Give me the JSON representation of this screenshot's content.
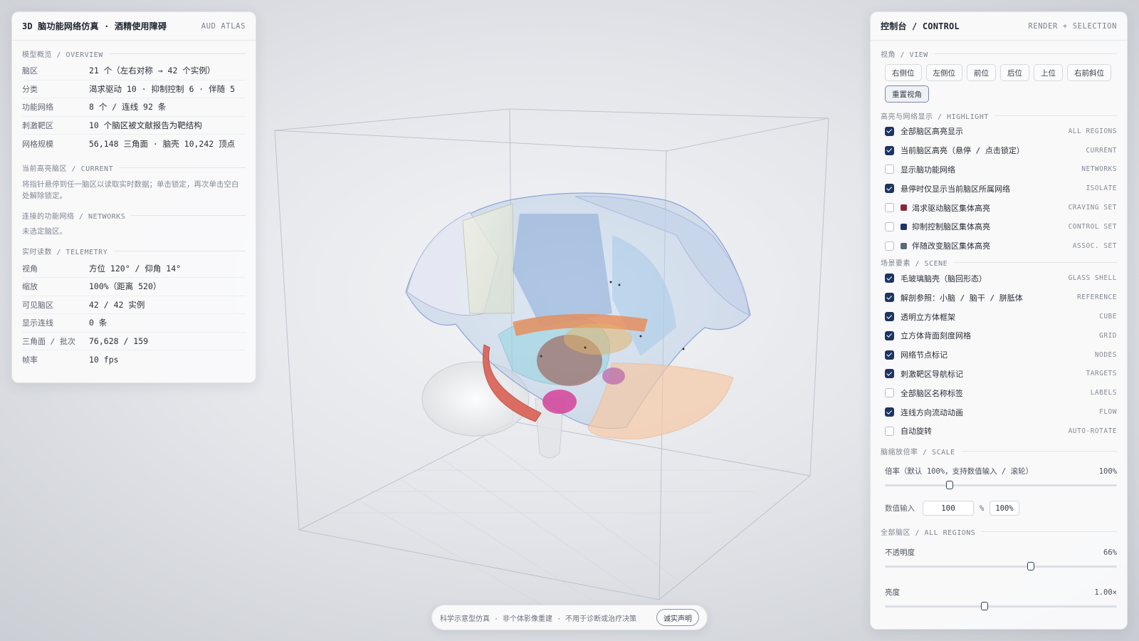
{
  "left_panel": {
    "title": "3D 脑功能网络仿真 · 酒精使用障碍",
    "tag": "AUD ATLAS",
    "overview": {
      "heading": "模型概览 / OVERVIEW",
      "rows": [
        {
          "key": "脑区",
          "value": "21 个（左右对称 → 42 个实例）"
        },
        {
          "key": "分类",
          "value": "渴求驱动 10 · 抑制控制 6 · 伴随 5"
        },
        {
          "key": "功能网络",
          "value": "8 个 / 连线 92 条"
        },
        {
          "key": "刺激靶区",
          "value": "10 个脑区被文献报告为靶结构"
        },
        {
          "key": "网格规模",
          "value": "56,148 三角面 · 脑壳 10,242 顶点"
        }
      ]
    },
    "current": {
      "heading": "当前高亮脑区 / CURRENT",
      "note": "将指针悬停到任一脑区以读取实时数据；单击锁定，再次单击空白处解除锁定。"
    },
    "networks": {
      "heading": "连接的功能网络 / NETWORKS",
      "note": "未选定脑区。"
    },
    "telemetry": {
      "heading": "实时读数 / TELEMETRY",
      "rows": [
        {
          "key": "视角",
          "value": "方位 120° / 仰角 14°"
        },
        {
          "key": "缩放",
          "value": "100%（距离 520）"
        },
        {
          "key": "可见脑区",
          "value": "42 / 42 实例"
        },
        {
          "key": "显示连线",
          "value": "0 条"
        },
        {
          "key": "三角面 / 批次",
          "value": "76,628 / 159"
        },
        {
          "key": "帧率",
          "value": "10 fps"
        }
      ]
    }
  },
  "right_panel": {
    "title": "控制台 / CONTROL",
    "tag": "RENDER + SELECTION",
    "view": {
      "heading": "视角 / VIEW",
      "buttons": [
        "右侧位",
        "左侧位",
        "前位",
        "后位",
        "上位",
        "右前斜位",
        "重置视角"
      ]
    },
    "highlight": {
      "heading": "高亮与网络显示 / HIGHLIGHT",
      "options": [
        {
          "label": "全部脑区高亮显示",
          "code": "ALL REGIONS",
          "checked": true
        },
        {
          "label": "当前脑区高亮（悬停 / 点击锁定）",
          "code": "CURRENT",
          "checked": true
        },
        {
          "label": "显示脑功能网络",
          "code": "NETWORKS",
          "checked": false
        },
        {
          "label": "悬停时仅显示当前脑区所属网络",
          "code": "ISOLATE",
          "checked": true
        },
        {
          "label": "渴求驱动脑区集体高亮",
          "code": "CRAVING SET",
          "checked": false,
          "color": "#8a2a34"
        },
        {
          "label": "抑制控制脑区集体高亮",
          "code": "CONTROL SET",
          "checked": false,
          "color": "#1e3563"
        },
        {
          "label": "伴随改变脑区集体高亮",
          "code": "ASSOC. SET",
          "checked": false,
          "color": "#5d6b70"
        }
      ]
    },
    "scene": {
      "heading": "场景要素 / SCENE",
      "options": [
        {
          "label": "毛玻璃脑壳（脑回形态）",
          "code": "GLASS SHELL",
          "checked": true
        },
        {
          "label": "解剖参照：小脑 / 脑干 / 胼胝体",
          "code": "REFERENCE",
          "checked": true
        },
        {
          "label": "透明立方体框架",
          "code": "CUBE",
          "checked": true
        },
        {
          "label": "立方体背面刻度网格",
          "code": "GRID",
          "checked": true
        },
        {
          "label": "网络节点标记",
          "code": "NODES",
          "checked": true
        },
        {
          "label": "刺激靶区导航标记",
          "code": "TARGETS",
          "checked": true
        },
        {
          "label": "全部脑区名称标签",
          "code": "LABELS",
          "checked": false
        },
        {
          "label": "连线方向流动动画",
          "code": "FLOW",
          "checked": true
        },
        {
          "label": "自动旋转",
          "code": "AUTO-ROTATE",
          "checked": false
        }
      ]
    },
    "scale": {
      "heading": "脑缩放倍率 / SCALE",
      "label": "倍率（默认 100%，支持数值输入 / 滚轮）",
      "value_text": "100%",
      "value": 0.28,
      "input_label": "数值输入",
      "input_value": "100",
      "unit": "%",
      "badge": "100%"
    },
    "all_regions": {
      "heading": "全部脑区 / ALL REGIONS",
      "opacity_label": "不透明度",
      "opacity_text": "66%",
      "opacity_value": 0.63,
      "brightness_label": "亮度",
      "brightness_text": "1.00×",
      "brightness_value": 0.43
    }
  },
  "disclaimer": {
    "text": "科学示意型仿真 · 非个体影像重建 · 不用于诊断或治疗决策",
    "button": "诚实声明"
  }
}
